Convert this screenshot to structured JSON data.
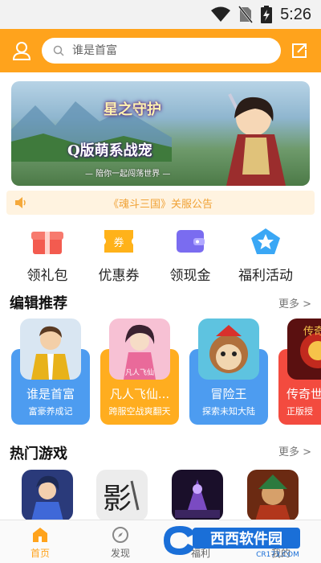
{
  "status_bar": {
    "time": "5:26"
  },
  "header": {
    "search_placeholder": "谁是首富"
  },
  "banner": {
    "logo_text": "星之守护",
    "title": "Q版萌系战宠",
    "subtitle": "— 陪你一起闯荡世界 —"
  },
  "notice": {
    "text": "《魂斗三国》关服公告"
  },
  "quick_links": [
    {
      "label": "领礼包",
      "icon": "gift-icon",
      "color": "#f35b4f"
    },
    {
      "label": "优惠券",
      "icon": "coupon-icon",
      "color": "#ffb21a"
    },
    {
      "label": "领现金",
      "icon": "wallet-icon",
      "color": "#7a6cf0"
    },
    {
      "label": "福利活动",
      "icon": "star-badge-icon",
      "color": "#3aa7f5"
    }
  ],
  "editor_picks": {
    "title": "编辑推荐",
    "more": "更多 >",
    "cards": [
      {
        "name": "谁是首富",
        "tag": "富豪养成记",
        "color": "#4d9cf0"
      },
      {
        "name": "凡人飞仙...",
        "tag": "跨服空战爽翻天",
        "color": "#ffad1f"
      },
      {
        "name": "冒险王",
        "tag": "探索未知大陆",
        "color": "#4d9cf0"
      },
      {
        "name": "传奇世",
        "tag": "正版授",
        "color": "#f34b3f"
      }
    ]
  },
  "hot_games": {
    "title": "热门游戏",
    "more": "更多 >",
    "icons": [
      "game-hero-icon",
      "game-ying-icon",
      "game-dark-icon",
      "game-warrior-icon"
    ]
  },
  "bottom_nav": [
    {
      "label": "首页",
      "icon": "home-icon",
      "active": true
    },
    {
      "label": "发现",
      "icon": "discover-icon",
      "active": false
    },
    {
      "label": "福利",
      "icon": "gift-icon",
      "active": false
    },
    {
      "label": "我的",
      "icon": "user-icon",
      "active": false
    }
  ],
  "watermark": {
    "text": "西西软件园",
    "url": "CR173.COM"
  },
  "colors": {
    "brand": "#ffa31c",
    "notice_text": "#f0a236"
  }
}
